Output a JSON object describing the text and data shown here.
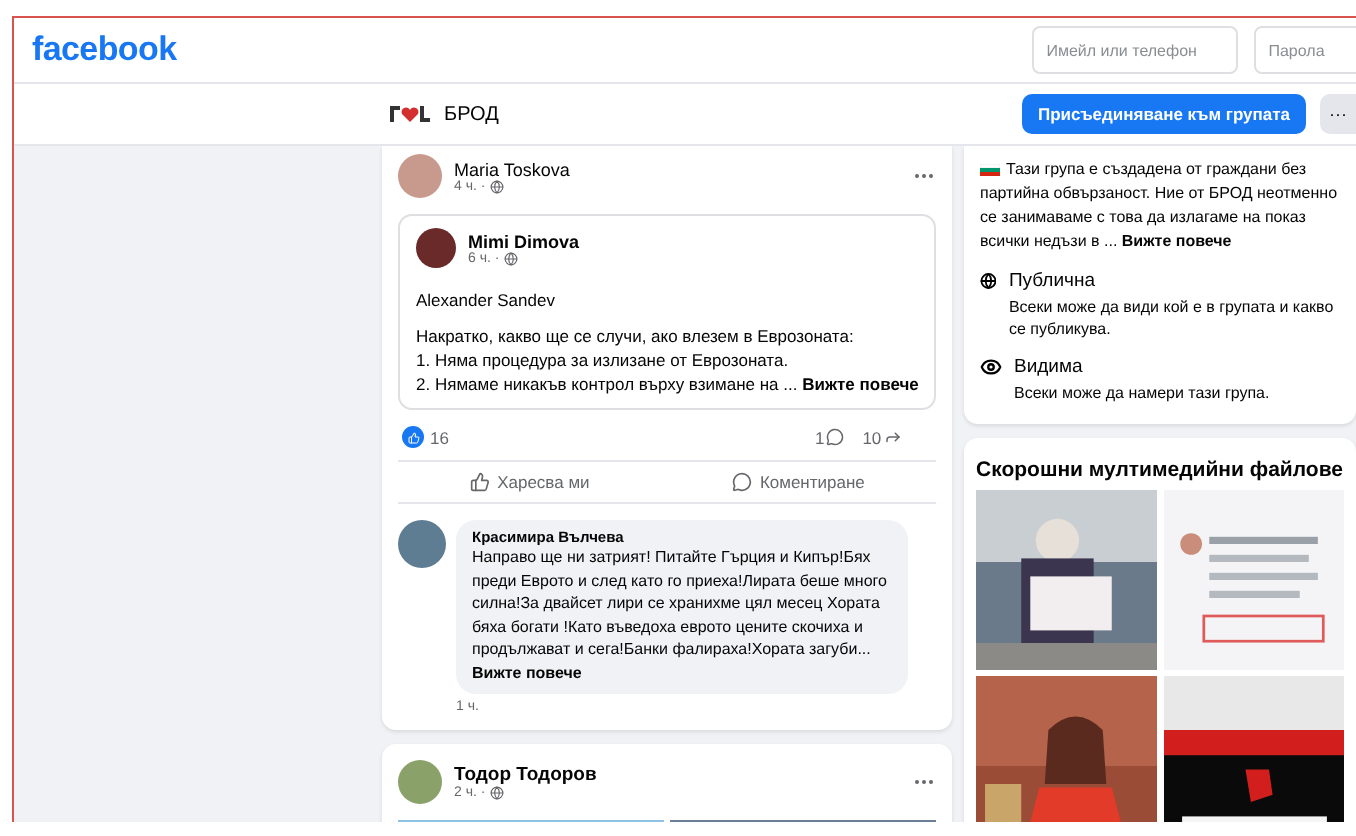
{
  "header": {
    "logo": "facebook",
    "email_placeholder": "Имейл или телефон",
    "password_placeholder": "Парола"
  },
  "group_bar": {
    "name": "БРОД",
    "join_button": "Присъединяване към групата",
    "more_button": "···"
  },
  "posts": [
    {
      "author": "Maria Toskova",
      "time": "4 ч. ·",
      "shared": {
        "author": "Mimi Dimova",
        "time": "6 ч. ·",
        "lines": [
          "Alexander Sandev",
          "Накратко, какво ще се случи, ако влезем в Еврозоната:",
          "1. Няма процедура за излизане от Еврозоната.",
          "2. Нямаме никакъв контрол върху взимане на ..."
        ],
        "see_more": "Вижте повече"
      },
      "reactions": "16",
      "comments": "1",
      "shares": "10",
      "actions": [
        "Харесва ми",
        "Коментиране"
      ],
      "comment": {
        "author": "Красимира Вълчева",
        "text": "Направо ще ни затрият! Питайте Гърция и Кипър!Бях преди Еврото и след като го приеха!Лирата беше много силна!За двайсет лири се хранихме цял месец Хората бяха богати !Като въведоха еврото цените скочиха и продължават и сега!Банки фалираха!Хората загуби...",
        "see_more": "Вижте повече",
        "time": "1 ч."
      }
    },
    {
      "author": "Тодор Тодоров",
      "time": "2 ч. ·"
    }
  ],
  "about": {
    "text": "Тази група е създадена от граждани без партийна обвързаност. Ние от БРОД неотменно се занимаваме с това да излагаме на показ всички недъзи в ...",
    "see_more": "Вижте повече",
    "items": [
      {
        "kind": "public",
        "title": "Публична",
        "description": "Всеки може да види кой е в групата и какво се публикува."
      },
      {
        "kind": "visible",
        "title": "Видима",
        "description": "Всеки може да намери тази група."
      }
    ]
  },
  "recent_media": {
    "title": "Скорошни мултимедийни файлове"
  }
}
